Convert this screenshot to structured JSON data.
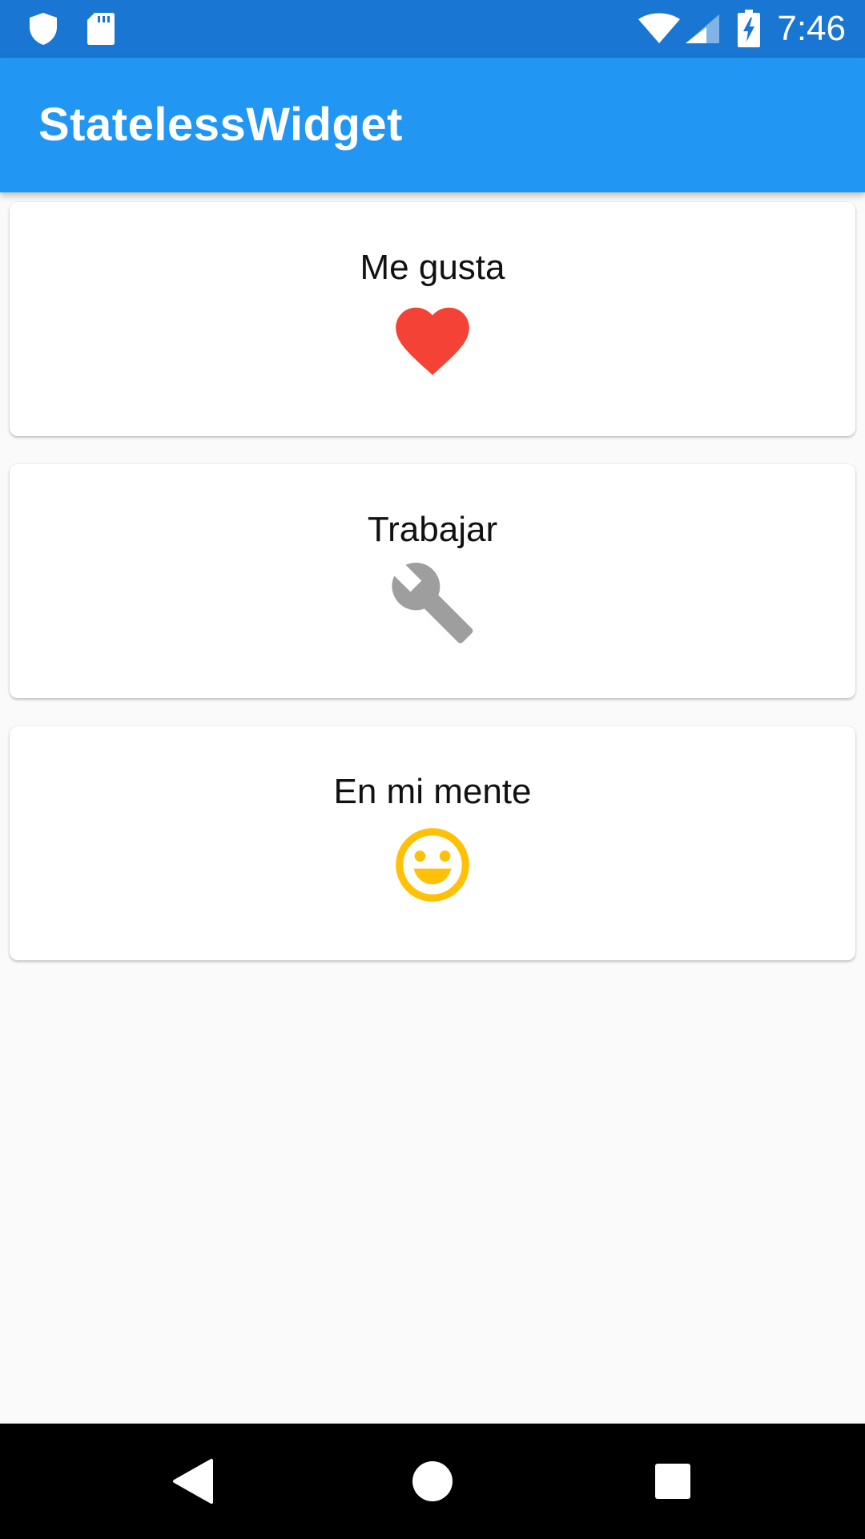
{
  "status_bar": {
    "time": "7:46",
    "icons": [
      "shield-icon",
      "sd-card-icon",
      "wifi-icon",
      "cell-signal-icon",
      "battery-charging-icon"
    ],
    "color": "#1976d2"
  },
  "app_bar": {
    "title": "StatelessWidget",
    "color": "#2196f3"
  },
  "cards": [
    {
      "label": "Me gusta",
      "icon": "heart-icon",
      "icon_color": "#f44336"
    },
    {
      "label": "Trabajar",
      "icon": "wrench-icon",
      "icon_color": "#9e9e9e"
    },
    {
      "label": "En mi mente",
      "icon": "smiley-icon",
      "icon_color": "#ffc107"
    }
  ],
  "nav_bar": {
    "buttons": [
      "back-icon",
      "home-icon",
      "recents-icon"
    ]
  }
}
